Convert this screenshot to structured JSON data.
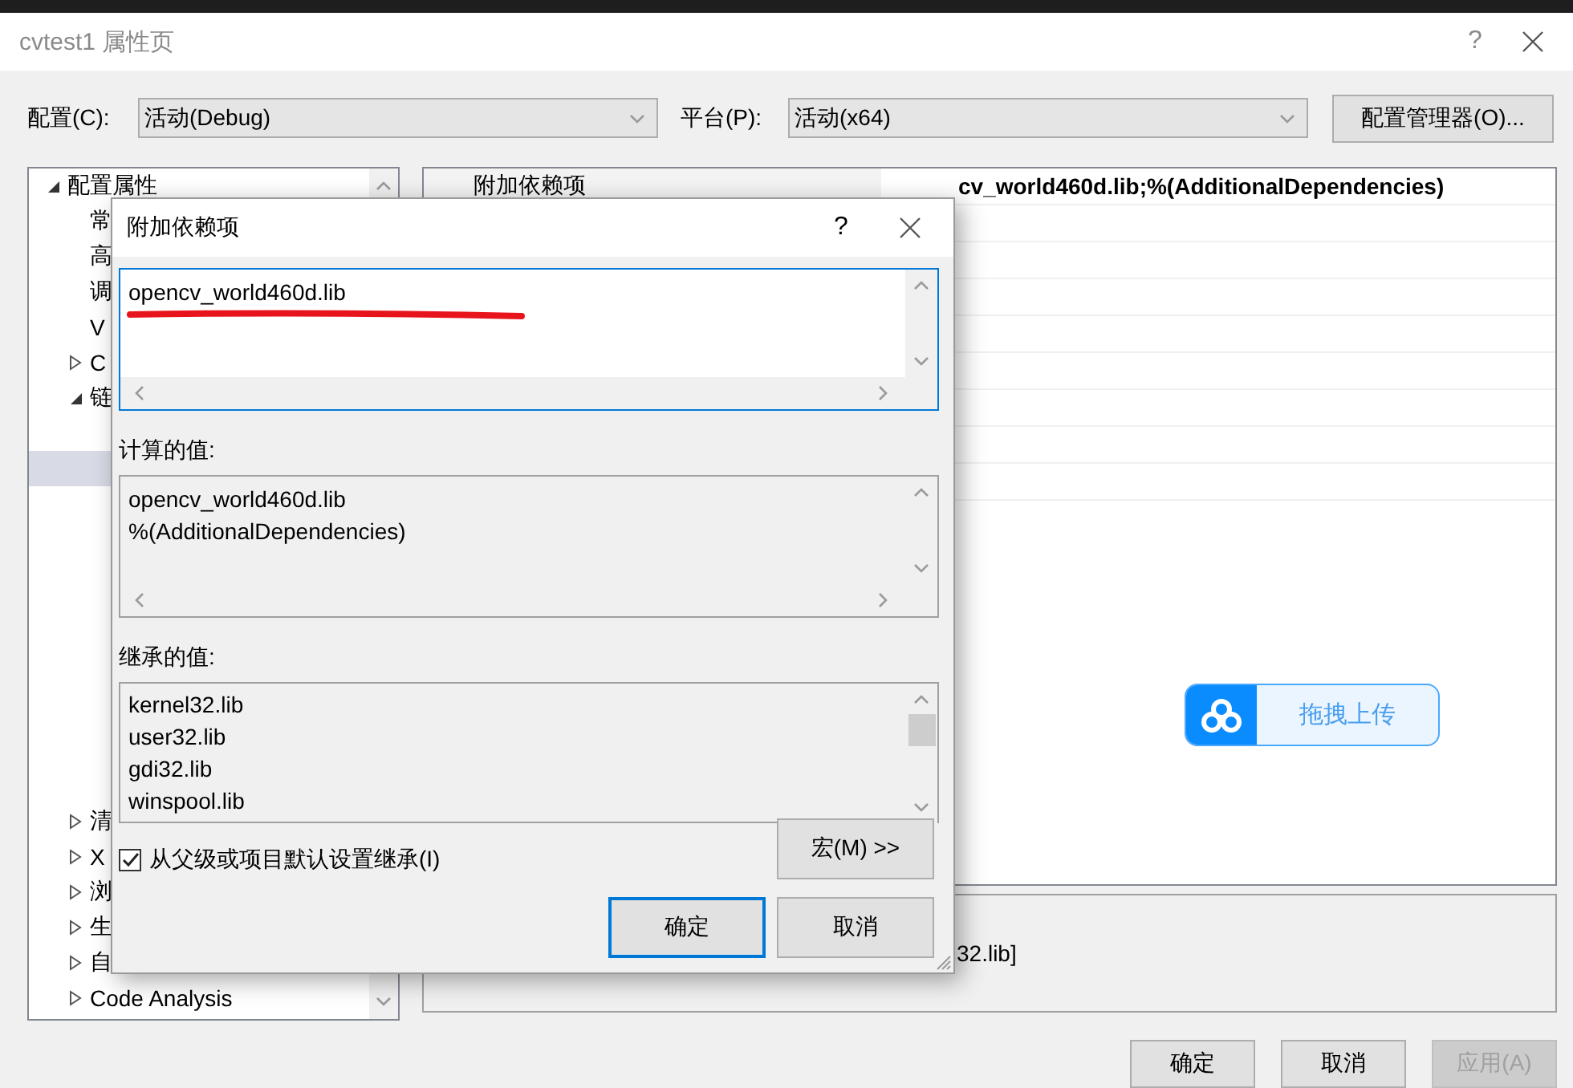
{
  "window": {
    "title": "cvtest1 属性页",
    "help_glyph": "?"
  },
  "config": {
    "label": "配置(C):",
    "value": "活动(Debug)"
  },
  "platform": {
    "label": "平台(P):",
    "value": "活动(x64)"
  },
  "config_manager_button": "配置管理器(O)...",
  "tree": [
    {
      "label": "配置属性",
      "expanded": true,
      "selected": false,
      "children": [
        {
          "label": "常",
          "selected": false
        },
        {
          "label": "高",
          "selected": false
        },
        {
          "label": "调",
          "selected": false
        },
        {
          "label": "V",
          "selected": false
        },
        {
          "label": "C",
          "expanded": false,
          "selected": false
        },
        {
          "label": "链",
          "expanded": true,
          "selected": false,
          "children": [
            {
              "selected": false
            },
            {
              "selected": true
            },
            {
              "selected": false
            },
            {
              "selected": false
            },
            {
              "selected": false
            },
            {
              "selected": false
            },
            {
              "selected": false
            },
            {
              "selected": false
            },
            {
              "selected": false
            },
            {
              "selected": false
            },
            {
              "selected": false
            }
          ]
        },
        {
          "label": "清",
          "expanded": false,
          "selected": false
        },
        {
          "label": "X",
          "expanded": false,
          "selected": false
        },
        {
          "label": "浏",
          "expanded": false,
          "selected": false
        },
        {
          "label": "生",
          "expanded": false,
          "selected": false
        },
        {
          "label": "自",
          "expanded": false,
          "selected": false
        },
        {
          "label": "Code Analysis",
          "expanded": false,
          "selected": false
        }
      ]
    }
  ],
  "property_grid": {
    "rows": [
      {
        "name": "附加依赖项",
        "value": "cv_world460d.lib;%(AdditionalDependencies)"
      }
    ]
  },
  "upload_widget": {
    "label": "拖拽上传"
  },
  "description": {
    "text": "32.lib]"
  },
  "buttons": [
    {
      "label": "确定",
      "disabled": false
    },
    {
      "label": "取消",
      "disabled": false
    },
    {
      "label": "应用(A)",
      "disabled": true
    }
  ],
  "dialog": {
    "title": "附加依赖项",
    "help_glyph": "?",
    "edit": {
      "value": "opencv_world460d.lib"
    },
    "computed": {
      "label": "计算的值:",
      "lines": [
        "opencv_world460d.lib",
        "%(AdditionalDependencies)"
      ]
    },
    "inherited": {
      "label": "继承的值:",
      "lines": [
        "kernel32.lib",
        "user32.lib",
        "gdi32.lib",
        "winspool.lib"
      ]
    },
    "inherit_checkbox": {
      "label": "从父级或项目默认设置继承(I)",
      "checked": true
    },
    "macro_button": "宏(M) >>",
    "buttons": [
      {
        "label": "确定",
        "default": true
      },
      {
        "label": "取消",
        "default": false
      }
    ]
  }
}
